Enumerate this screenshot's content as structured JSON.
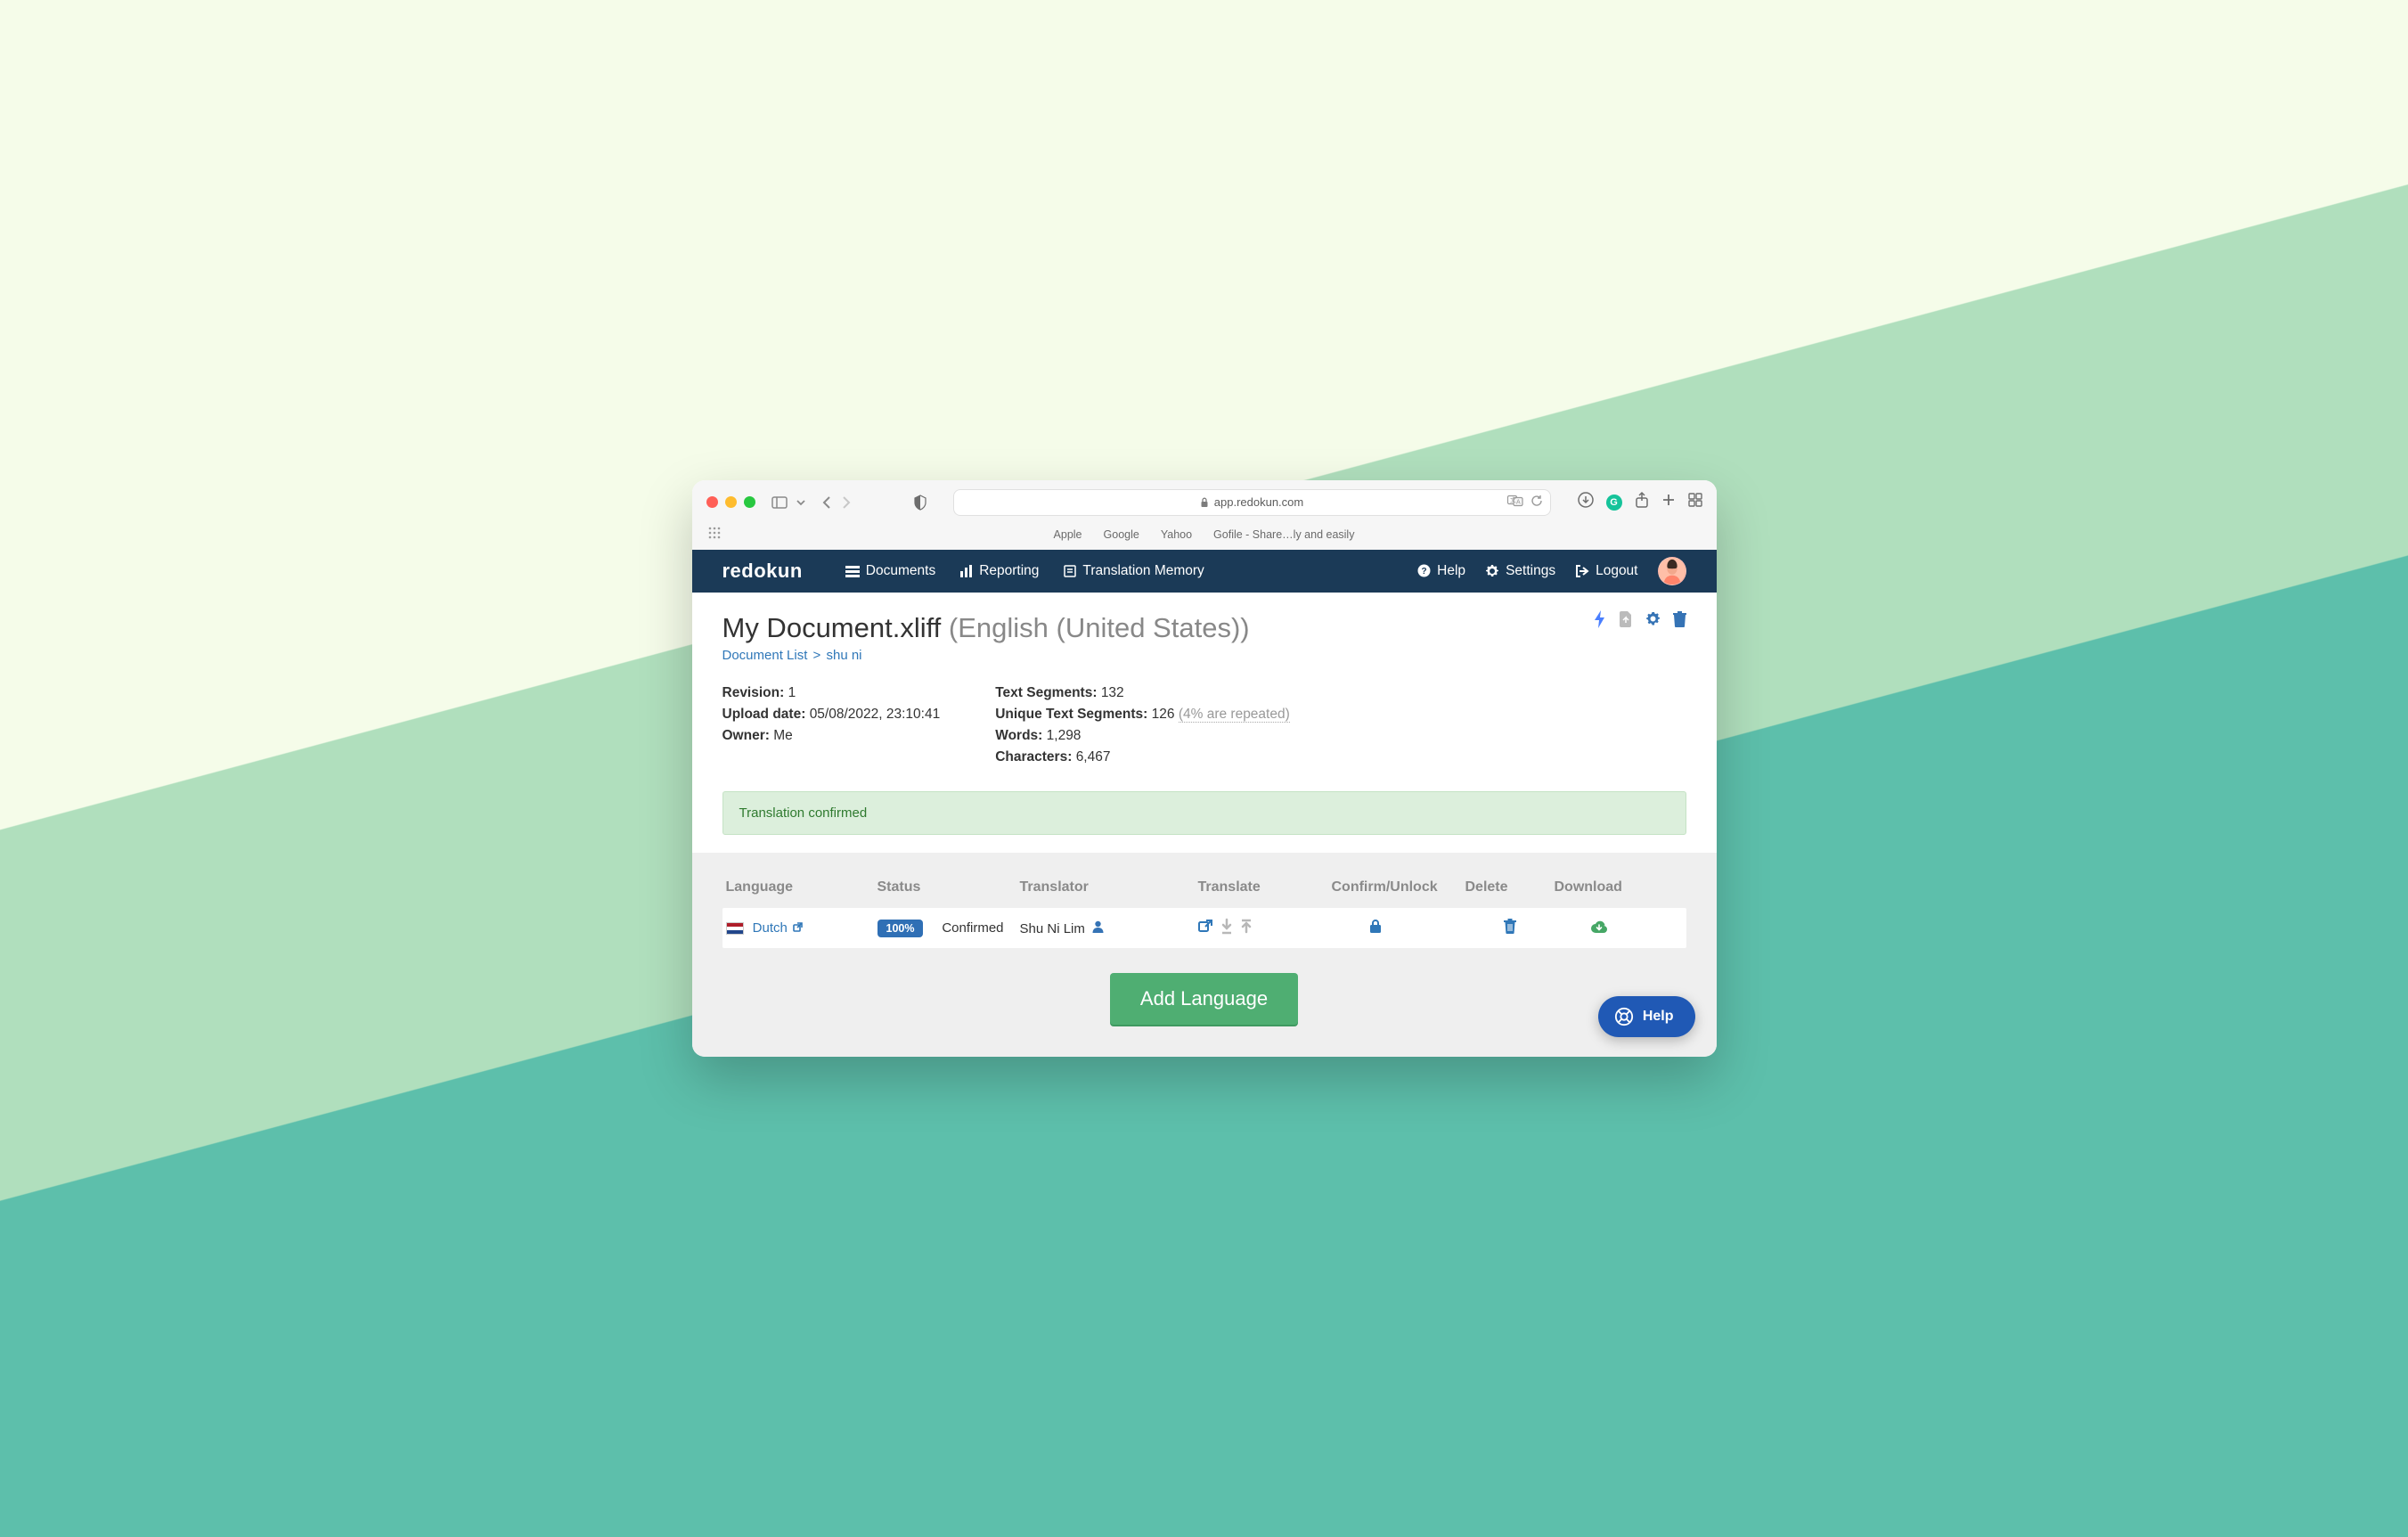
{
  "browser": {
    "url_host": "app.redokun.com",
    "bookmarks": [
      "Apple",
      "Google",
      "Yahoo",
      "Gofile - Share…ly and easily"
    ]
  },
  "nav": {
    "logo": "redokun",
    "documents": "Documents",
    "reporting": "Reporting",
    "tm": "Translation Memory",
    "help": "Help",
    "settings": "Settings",
    "logout": "Logout"
  },
  "doc": {
    "title": "My Document.xliff",
    "language_label": "(English (United States))",
    "breadcrumb_root": "Document List",
    "breadcrumb_current": "shu ni",
    "revision_label": "Revision:",
    "revision_value": "1",
    "upload_label": "Upload date:",
    "upload_value": "05/08/2022, 23:10:41",
    "owner_label": "Owner:",
    "owner_value": "Me",
    "text_segments_label": "Text Segments:",
    "text_segments_value": "132",
    "unique_segments_label": "Unique Text Segments:",
    "unique_segments_value": "126",
    "unique_segments_repeated": "(4% are repeated)",
    "words_label": "Words:",
    "words_value": "1,298",
    "characters_label": "Characters:",
    "characters_value": "6,467"
  },
  "alert": {
    "message": "Translation confirmed"
  },
  "table": {
    "headers": {
      "language": "Language",
      "status": "Status",
      "translator": "Translator",
      "translate": "Translate",
      "confirm": "Confirm/Unlock",
      "delete": "Delete",
      "download": "Download"
    },
    "row": {
      "language": "Dutch",
      "status_pct": "100%",
      "status_text": "Confirmed",
      "translator": "Shu Ni Lim"
    }
  },
  "buttons": {
    "add_language": "Add Language"
  },
  "fab": {
    "label": "Help"
  }
}
